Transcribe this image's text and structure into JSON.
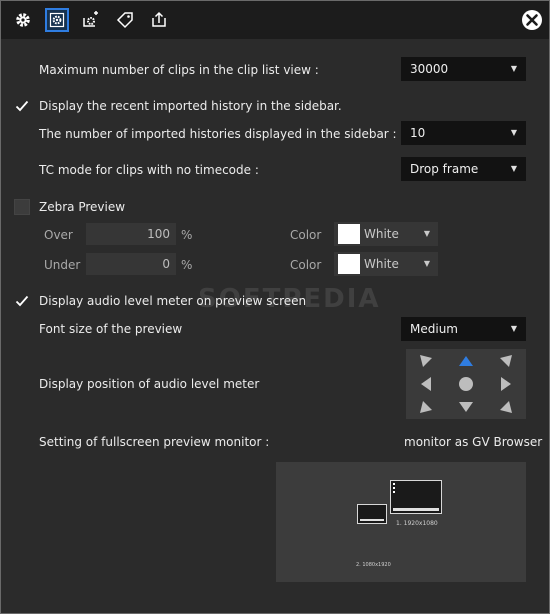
{
  "toolbar": {
    "buttons": [
      {
        "icon": "gear-icon",
        "active": false
      },
      {
        "icon": "settings-panel-icon",
        "active": true
      },
      {
        "icon": "import-icon",
        "active": false
      },
      {
        "icon": "tag-icon",
        "active": false
      },
      {
        "icon": "export-icon",
        "active": false
      }
    ],
    "close_icon": "close-icon"
  },
  "settings": {
    "max_clips_label": "Maximum number of clips in the clip list view :",
    "max_clips_value": "30000",
    "recent_history": {
      "label": "Display the recent imported history in the sidebar.",
      "checked": true
    },
    "history_count_label": "The number of imported histories displayed in the sidebar :",
    "history_count_value": "10",
    "tc_mode_label": "TC mode for clips with no timecode :",
    "tc_mode_value": "Drop frame",
    "zebra": {
      "label": "Zebra Preview",
      "checked": false,
      "over_label": "Over",
      "over_value": "100",
      "over_unit": "%",
      "over_color_label": "Color",
      "over_color_value": "White",
      "under_label": "Under",
      "under_value": "0",
      "under_unit": "%",
      "under_color_label": "Color",
      "under_color_value": "White"
    },
    "audio_meter": {
      "label": "Display audio level meter on preview screen",
      "checked": true
    },
    "font_size_label": "Font size of the preview",
    "font_size_value": "Medium",
    "meter_position_label": "Display position of audio level meter",
    "meter_position_selected": "top-center",
    "fullscreen_label": "Setting of fullscreen preview monitor :",
    "fullscreen_value": "monitor as GV Browser",
    "monitors": [
      {
        "label": "1. 1920x1080"
      },
      {
        "label": "2. 1080x1920"
      }
    ]
  },
  "watermark": "SOFTPEDIA",
  "colors": {
    "accent": "#2f7de1",
    "background": "#2b2b2b",
    "toolbar": "#1c1c1c",
    "field": "#121212"
  }
}
